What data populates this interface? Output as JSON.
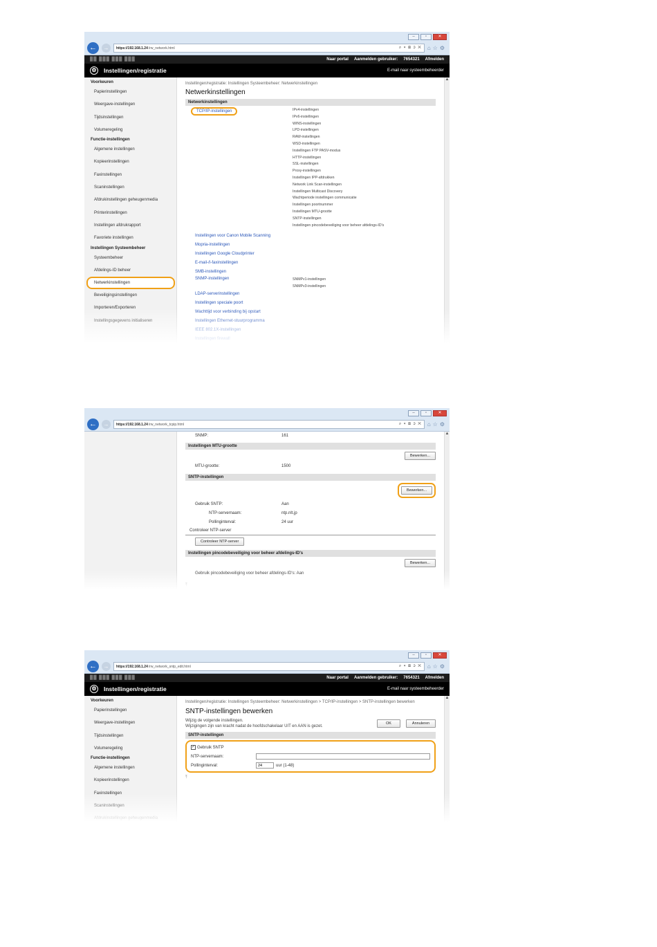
{
  "browser": {
    "url_host": "https://192.168.1.24",
    "urls": [
      "/rw_network.html",
      "/rw_network_tcpip.html",
      "/rw_network_sntp_edit.html"
    ],
    "url_hosts": [
      "https://192.168.1.24",
      "https://192.168.1.24",
      "https://192.168.1.24"
    ],
    "tools": "⌕ ▾ ⊠ ɔ ✕"
  },
  "header": {
    "portal": "Naar portal",
    "login_user": "Aanmelden gebruiker:",
    "user_id": "7654321",
    "logout": "Afmelden",
    "title": "Instellingen/registratie",
    "email": "E-mail naar systeembeheerder"
  },
  "sidebar": {
    "heading1": "Voorkeuren",
    "group1": [
      "Papierinstellingen",
      "Weergave-instellingen",
      "Tijdsinstellingen",
      "Volumeregeling"
    ],
    "heading2": "Functie-instellingen",
    "group2": [
      "Algemene instellingen",
      "Kopieerinstellingen",
      "Faxinstellingen",
      "Scaninstellingen",
      "Afdrukinstellingen geheugenmedia",
      "Printerinstellingen",
      "Instellingen afdrukrapport",
      "Favoriete instellingen"
    ],
    "heading3": "Instellingen Systeembeheer",
    "group3": [
      "Systeembeheer",
      "Afdelings-ID beheer",
      "Netwerkinstellingen",
      "Beveiligingsinstellingen",
      "Importeren/Exporteren",
      "Instellingsgegevens initialiseren"
    ]
  },
  "shot1": {
    "crumb": "Instellingen/registratie: Instellingen Systeembeheer: Netwerkinstellingen",
    "title": "Netwerkinstellingen",
    "section": "Netwerkinstellingen",
    "tcpip": "TCP/IP-instellingen",
    "tcpip_sub": [
      "IPv4-instellingen",
      "IPv6-instellingen",
      "WINS-instellingen",
      "LPD-instellingen",
      "RAW-instellingen",
      "WSD-instellingen",
      "Instellingen FTP PASV-modus",
      "HTTP-instellingen",
      "SSL-instellingen",
      "Proxy-instellingen",
      "Instellingen IPP-afdrukken",
      "Network Link Scan-instellingen",
      "Instellingen Multicast Discovery",
      "Wachtperiode instellingen communicatie",
      "Instellingen poortnummer",
      "Instellingen MTU-grootte",
      "SNTP-instellingen",
      "Instellingen pincodebeveiliging voor beheer afdelings-ID's"
    ],
    "links_a": [
      "Instellingen voor Canon Mobile Scanning",
      "Mopria-instellingen",
      "Instellingen Google Cloudprinter",
      "E-mail-/I-faxinstellingen",
      "SMB-instellingen"
    ],
    "snmp": "SNMP-instellingen",
    "snmp_sub": [
      "SNMPv1-instellingen",
      "SNMPv3-instellingen"
    ],
    "links_b": [
      "LDAP-serverinstellingen",
      "Instellingen speciale poort",
      "Wachttijd voor verbinding bij opstart",
      "Instellingen Ethernet-stuurprogramma",
      "IEEE 802.1X-instellingen",
      "Instellingen firewall"
    ]
  },
  "shot2": {
    "snmp_label": "SNMP:",
    "snmp_value": "161",
    "mtu_section": "Instellingen MTU-grootte",
    "edit": "Bewerken...",
    "mtu_label": "MTU-grootte:",
    "mtu_value": "1500",
    "sntp_section": "SNTP-instellingen",
    "use_label": "Gebruik SNTP:",
    "use_value": "Aan",
    "ntp_label": "NTP-servernaam:",
    "ntp_value": "ntp.nlt.jp",
    "poll_label": "Pollinginterval:",
    "poll_value": "24 uur",
    "check_label": "Controleer NTP-server",
    "check_button": "Controleer NTP-server",
    "pin_section": "Instellingen pincodebeveiliging voor beheer afdelings-ID's",
    "pin_label": "Gebruik pincodebeveiliging voor beheer afdelings-ID's:",
    "pin_value": "Aan",
    "top_marker": "⤒"
  },
  "shot3": {
    "crumb": "Instellingen/registratie: Instellingen Systeembeheer: Netwerkinstellingen > TCP/IP-instellingen > SNTP-instellingen bewerken",
    "title": "SNTP-instellingen bewerken",
    "instr1": "Wijzig de volgende instellingen.",
    "instr2": "Wijzigingen zijn van kracht nadat de hoofdschakelaar UIT en AAN is gezet.",
    "ok": "OK",
    "cancel": "Annuleren",
    "section": "SNTP-instellingen",
    "use_label": "Gebruik SNTP",
    "ntp_label": "NTP-servernaam:",
    "ntp_value": "",
    "poll_label": "Pollinginterval:",
    "poll_value": "24",
    "poll_unit": "uur (1-48)",
    "top_marker": "⤒"
  }
}
